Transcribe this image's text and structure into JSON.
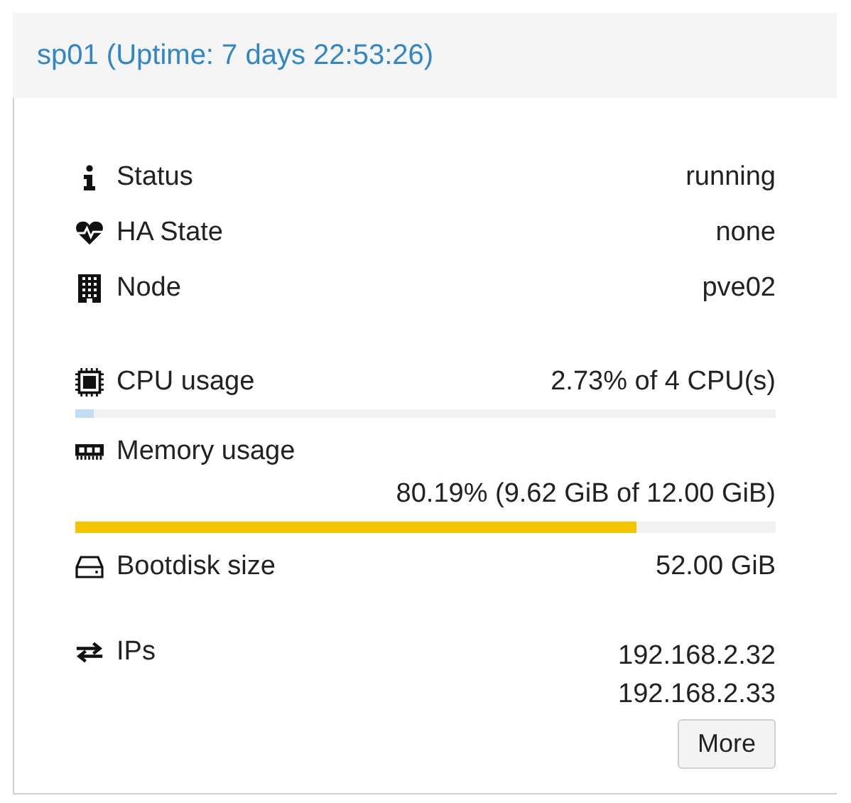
{
  "panel": {
    "title": "sp01 (Uptime: 7 days 22:53:26)"
  },
  "info_rows": [
    {
      "label": "Status",
      "value": "running"
    },
    {
      "label": "HA State",
      "value": "none"
    },
    {
      "label": "Node",
      "value": "pve02"
    }
  ],
  "usage_rows": [
    {
      "kind": "inline",
      "label": "CPU usage",
      "value": "2.73% of 4 CPU(s)",
      "level": 0.0273,
      "color": "#c2ddf2"
    },
    {
      "kind": "stacked",
      "label": "Memory usage",
      "value": "80.19% (9.62 GiB of 12.00 GiB)",
      "level": 0.8019,
      "color": "#f5c400"
    },
    {
      "kind": "plain",
      "label": "Bootdisk size",
      "value": "52.00 GiB"
    }
  ],
  "ips": {
    "label": "IPs",
    "values": [
      "192.168.2.32",
      "192.168.2.33"
    ],
    "button": "More"
  }
}
